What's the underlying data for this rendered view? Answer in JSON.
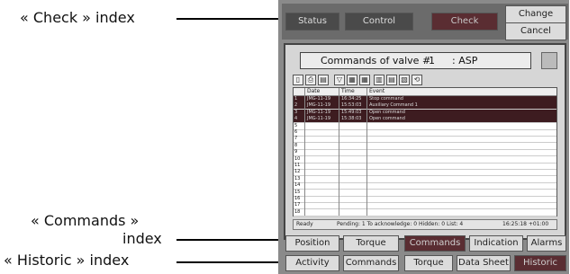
{
  "annotations": {
    "check": "« Check » index",
    "commands_line1": "« Commands »",
    "commands_line2": "index",
    "historic": "« Historic » index"
  },
  "top_tabs": {
    "status": "Status",
    "control": "Control",
    "check": "Check",
    "change": "Change",
    "cancel": "Cancel"
  },
  "commands_header": {
    "label": "Commands of valve #",
    "number": "1",
    "tag": ": ASP"
  },
  "grid": {
    "columns": [
      "Date",
      "Time",
      "Event"
    ],
    "rows": [
      {
        "n": "1",
        "date": "JMG-11-19",
        "time": "16:34:25",
        "event": "Stop command",
        "highlight": true
      },
      {
        "n": "2",
        "date": "JMG-11-19",
        "time": "15:53:03",
        "event": "Auxiliary Command 1",
        "highlight": true
      },
      {
        "n": "3",
        "date": "JMG-11-19",
        "time": "15:49:03",
        "event": "Open command",
        "highlight": true
      },
      {
        "n": "4",
        "date": "JMG-11-19",
        "time": "15:38:03",
        "event": "Open command",
        "highlight": true
      },
      {
        "n": "5",
        "date": "",
        "time": "",
        "event": "",
        "highlight": false
      },
      {
        "n": "6",
        "date": "",
        "time": "",
        "event": "",
        "highlight": false
      },
      {
        "n": "7",
        "date": "",
        "time": "",
        "event": "",
        "highlight": false
      },
      {
        "n": "8",
        "date": "",
        "time": "",
        "event": "",
        "highlight": false
      },
      {
        "n": "9",
        "date": "",
        "time": "",
        "event": "",
        "highlight": false
      },
      {
        "n": "10",
        "date": "",
        "time": "",
        "event": "",
        "highlight": false
      },
      {
        "n": "11",
        "date": "",
        "time": "",
        "event": "",
        "highlight": false
      },
      {
        "n": "12",
        "date": "",
        "time": "",
        "event": "",
        "highlight": false
      },
      {
        "n": "13",
        "date": "",
        "time": "",
        "event": "",
        "highlight": false
      },
      {
        "n": "14",
        "date": "",
        "time": "",
        "event": "",
        "highlight": false
      },
      {
        "n": "15",
        "date": "",
        "time": "",
        "event": "",
        "highlight": false
      },
      {
        "n": "16",
        "date": "",
        "time": "",
        "event": "",
        "highlight": false
      },
      {
        "n": "17",
        "date": "",
        "time": "",
        "event": "",
        "highlight": false
      },
      {
        "n": "18",
        "date": "",
        "time": "",
        "event": "",
        "highlight": false
      }
    ]
  },
  "status_bar": {
    "ready": "Ready",
    "pending": "Pending: 1  To acknowledge: 0  Hidden: 0  List: 4",
    "time": "16:25:18 +01:00"
  },
  "mid_tabs": {
    "position": "Position",
    "torque": "Torque",
    "commands": "Commands",
    "indication": "Indication",
    "alarms": "Alarms"
  },
  "bottom_tabs": {
    "activity": "Activity",
    "commands": "Commands",
    "torque": "Torque",
    "data_sheet": "Data Sheet",
    "historic": "Historic"
  },
  "icons": [
    "print-icon",
    "save-icon",
    "filter-icon",
    "table-icon",
    "lock-icon"
  ],
  "colors": {
    "active_tab": "#5a2d32",
    "panel": "#8a8a8a",
    "highlight_row": "#3d1c20"
  }
}
